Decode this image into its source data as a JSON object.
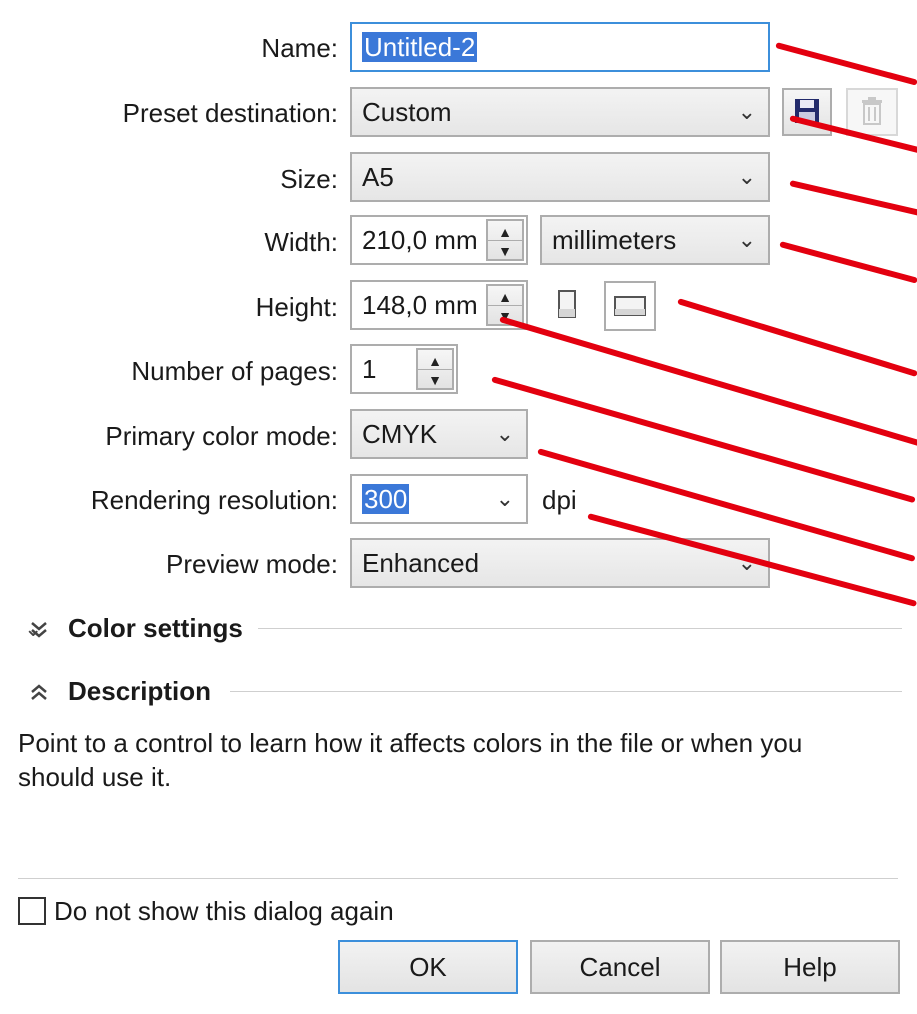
{
  "form": {
    "name_label": "Name:",
    "name_value": "Untitled-2",
    "preset_label": "Preset destination:",
    "preset_value": "Custom",
    "size_label": "Size:",
    "size_value": "A5",
    "width_label": "Width:",
    "width_value": "210,0 mm",
    "units_value": "millimeters",
    "height_label": "Height:",
    "height_value": "148,0 mm",
    "pages_label": "Number of pages:",
    "pages_value": "1",
    "color_mode_label": "Primary color mode:",
    "color_mode_value": "CMYK",
    "resolution_label": "Rendering resolution:",
    "resolution_value": "300",
    "resolution_unit": "dpi",
    "preview_label": "Preview mode:",
    "preview_value": "Enhanced"
  },
  "sections": {
    "color_settings": "Color settings",
    "description": "Description"
  },
  "description_text": "Point to a control to learn how it affects colors in the file or when you should use it.",
  "checkbox_label": "Do not show this dialog again",
  "buttons": {
    "ok": "OK",
    "cancel": "Cancel",
    "help": "Help"
  },
  "icons": {
    "save": "save-preset-icon",
    "delete": "delete-preset-icon",
    "portrait": "portrait-orientation-icon",
    "landscape": "landscape-orientation-icon",
    "expand": "expand-section-icon",
    "collapse": "collapse-section-icon",
    "chevron": "chevron-down-icon"
  },
  "colors": {
    "selection": "#3b78d8",
    "annotation_line": "#e3000f",
    "focus_border": "#3c8fdb"
  }
}
